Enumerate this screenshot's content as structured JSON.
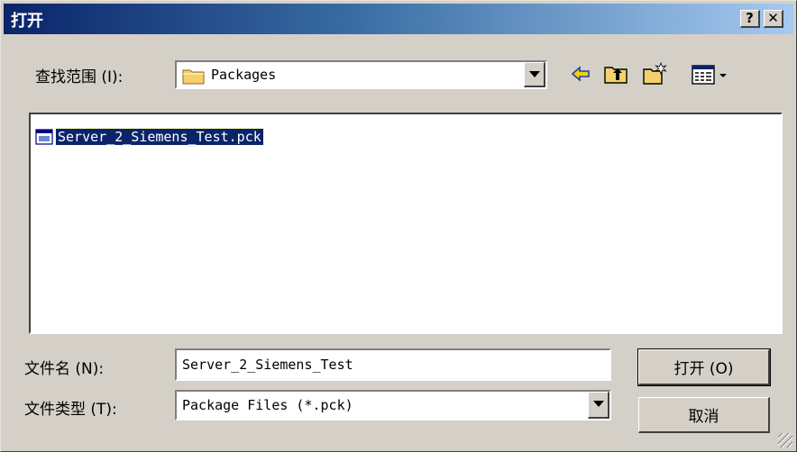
{
  "window": {
    "title": "打开",
    "help": "?",
    "close": "✕"
  },
  "lookin": {
    "label": "查找范围 (I):",
    "value": "Packages"
  },
  "files": [
    {
      "name": "Server_2_Siemens_Test.pck"
    }
  ],
  "filename": {
    "label": "文件名 (N):",
    "value": "Server_2_Siemens_Test"
  },
  "filetype": {
    "label": "文件类型 (T):",
    "value": "Package Files (*.pck)"
  },
  "buttons": {
    "open": "打开 (O)",
    "cancel": "取消"
  },
  "colors": {
    "accent": "#0a246a",
    "folder": "#f5d16b",
    "back_arrow": "#f2d200"
  }
}
